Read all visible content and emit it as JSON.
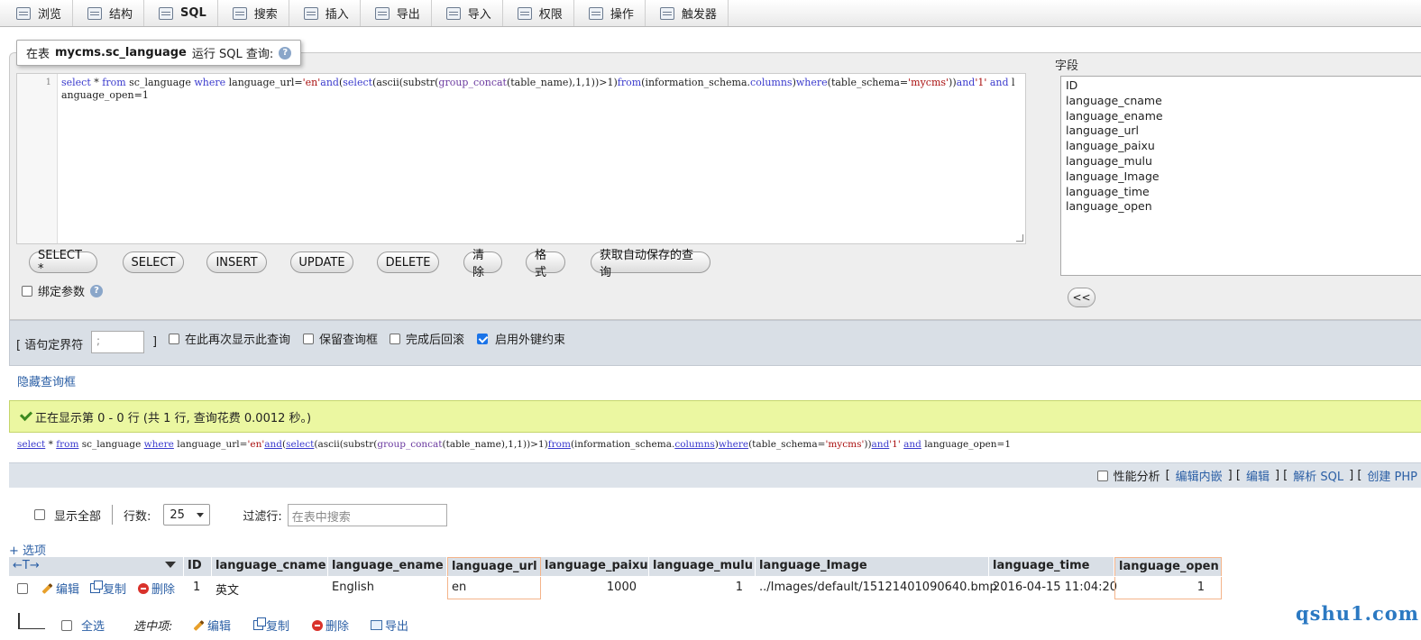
{
  "tabs": [
    {
      "label": "浏览",
      "icon": "browse-icon"
    },
    {
      "label": "结构",
      "icon": "structure-icon"
    },
    {
      "label": "SQL",
      "icon": "sql-icon"
    },
    {
      "label": "搜索",
      "icon": "search-icon"
    },
    {
      "label": "插入",
      "icon": "insert-icon"
    },
    {
      "label": "导出",
      "icon": "export-icon"
    },
    {
      "label": "导入",
      "icon": "import-icon"
    },
    {
      "label": "权限",
      "icon": "privileges-icon"
    },
    {
      "label": "操作",
      "icon": "operations-icon"
    },
    {
      "label": "触发器",
      "icon": "triggers-icon"
    }
  ],
  "query_box": {
    "legend_prefix": "在表",
    "table_name": "mycms.sc_language",
    "legend_suffix": "运行 SQL 查询:",
    "help": "?",
    "line_number": "1",
    "buttons": [
      "SELECT *",
      "SELECT",
      "INSERT",
      "UPDATE",
      "DELETE",
      "清除",
      "格式",
      "获取自动保存的查询"
    ],
    "bind_params_label": "绑定参数"
  },
  "query_tokens": {
    "t1": "select",
    "t2": " * ",
    "t3": "from",
    "t4": " sc_language ",
    "t5": "where",
    "t6": " language_url=",
    "t7": "'en'",
    "t8": "and",
    "t9": "(",
    "t10": "select",
    "t11": "(ascii(substr(",
    "t12": "group_concat",
    "t13": "(table_name),1,1))>1)",
    "t14": "from",
    "t15": "(information_schema.",
    "t16": "columns",
    "t17": ")",
    "t18": "where",
    "t19": "(table_schema=",
    "t20": "'mycms'",
    "t21": "))",
    "t22": "and",
    "t23": "'1'",
    "t24": " ",
    "t25": "and",
    "t26": " language_open=1"
  },
  "fields": {
    "label": "字段",
    "items": [
      "ID",
      "language_cname",
      "language_ename",
      "language_url",
      "language_paixu",
      "language_mulu",
      "language_Image",
      "language_time",
      "language_open"
    ],
    "insert_button": "<<"
  },
  "options": {
    "delimiter_label": "[ 语句定界符",
    "delimiter_value": ";",
    "delimiter_close": "]",
    "show_again": "在此再次显示此查询",
    "keep_box": "保留查询框",
    "rollback": "完成后回滚",
    "fk_checks": "启用外键约束"
  },
  "hide_query_box": "隐藏查询框",
  "result": {
    "status": "正在显示第 0 - 0 行 (共 1 行, 查询花费 0.0012 秒。)",
    "profiling": "性能分析",
    "links": [
      "编辑内嵌",
      "编辑",
      "解析 SQL",
      "创建 PHP"
    ]
  },
  "nav": {
    "show_all": "显示全部",
    "rows_label": "行数:",
    "rows_value": "25",
    "filter_label": "过滤行:",
    "filter_placeholder": "在表中搜索"
  },
  "table": {
    "options_link": "+ 选项",
    "arrows": "←T→",
    "columns": [
      "ID",
      "language_cname",
      "language_ename",
      "language_url",
      "language_paixu",
      "language_mulu",
      "language_Image",
      "language_time",
      "language_open"
    ],
    "row": {
      "actions": [
        "编辑",
        "复制",
        "删除"
      ],
      "values": [
        "1",
        "英文",
        "English",
        "en",
        "1000",
        "1",
        "../Images/default/15121401090640.bmp",
        "2016-04-15 11:04:20",
        "1"
      ]
    }
  },
  "bulk": {
    "check_all": "全选",
    "with_selected": "选中项:",
    "actions": [
      "编辑",
      "复制",
      "删除",
      "导出"
    ]
  },
  "watermark": "qshu1.com"
}
